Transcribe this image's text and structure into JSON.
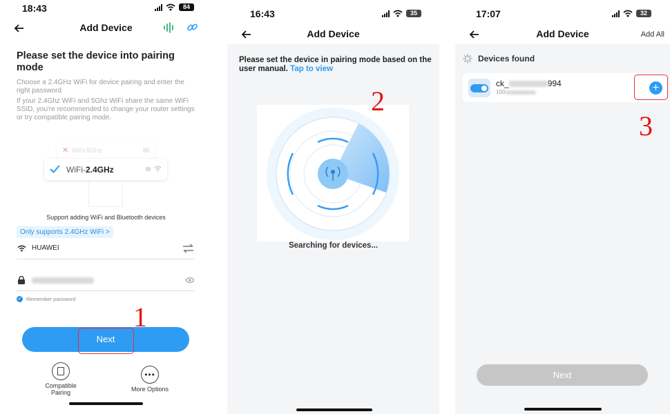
{
  "panel1": {
    "time": "18:43",
    "battery": "84",
    "title": "Add Device",
    "heading": "Please set the device into pairing mode",
    "desc1": "Choose a 2.4GHz WiFi for device pairing and enter the right password",
    "desc2": "If your 2.4Ghz WiFi and 5Ghz WiFi share the same WiFi SSID, you're recommended to change your router settings or try compatible pairing mode.",
    "wifi5": "WiFi-5GHz",
    "wifi24_prefix": "WiFi-",
    "wifi24_bold": "2.4GHz",
    "support": "Support adding WiFi and Bluetooth devices",
    "only": "Only supports 2.4GHz WiFi >",
    "ssid": "HUAWEI",
    "remember": "Remember password",
    "next": "Next",
    "opt1": "Compatible Pairing",
    "opt2": "More Options",
    "step": "1"
  },
  "panel2": {
    "time": "16:43",
    "battery": "35",
    "title": "Add Device",
    "heading": "Please set the device in pairing mode based on the user manual.",
    "link": "Tap to view",
    "searching": "Searching for devices...",
    "step": "2"
  },
  "panel3": {
    "time": "17:07",
    "battery": "32",
    "title": "Add Device",
    "add_all": "Add All",
    "found": "Devices found",
    "dev_prefix": "ck_",
    "dev_suffix": "994",
    "dev_id_prefix": "100",
    "next": "Next",
    "step": "3"
  },
  "colors": {
    "accent": "#2d9cf2",
    "annotation": "#e01818"
  }
}
